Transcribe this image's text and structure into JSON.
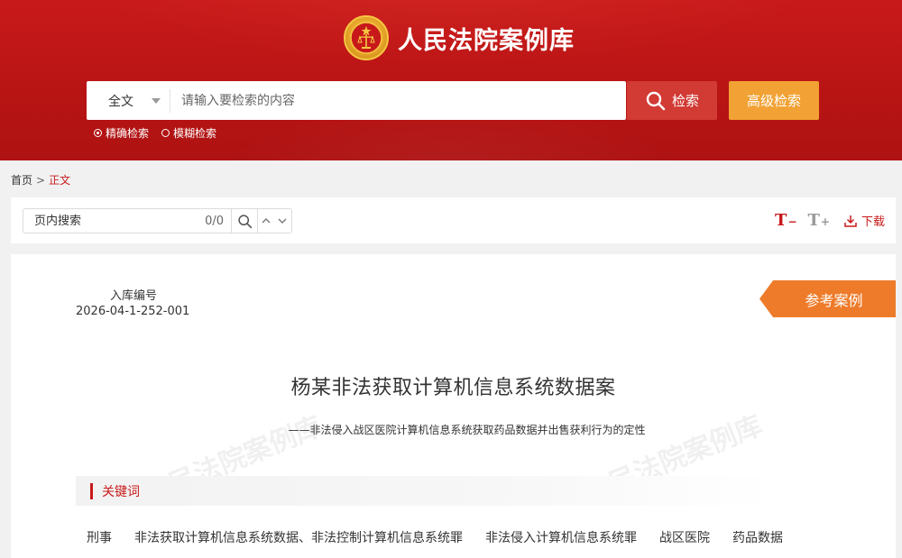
{
  "header": {
    "site_title": "人民法院案例库",
    "emblem_icon": "court-emblem-icon",
    "search": {
      "type_selected": "全文",
      "placeholder": "请输入要检索的内容",
      "search_button": "检索",
      "advanced_button": "高级检索"
    },
    "modes": [
      {
        "label": "精确检索",
        "selected": true
      },
      {
        "label": "模糊检索",
        "selected": false
      }
    ]
  },
  "breadcrumb": {
    "home": "首页",
    "separator": ">",
    "current": "正文"
  },
  "toolbar": {
    "find_placeholder": "页内搜索",
    "find_count": "0/0",
    "font_decrease_label": "T",
    "font_decrease_sub": "−",
    "font_increase_label": "T",
    "font_increase_sub": "+",
    "download_label": "下载"
  },
  "case": {
    "ref_no_label": "入库编号",
    "ref_no": "2026-04-1-252-001",
    "tag": "参考案例",
    "title": "杨某非法获取计算机信息系统数据案",
    "subtitle": "——非法侵入战区医院计算机信息系统获取药品数据并出售获利行为的定性",
    "watermark": "人民法院案例库",
    "keywords_heading": "关键词",
    "keywords": [
      "刑事",
      "非法获取计算机信息系统数据、非法控制计算机信息系统罪",
      "非法侵入计算机信息系统罪",
      "战区医院",
      "药品数据"
    ]
  },
  "colors": {
    "brand_red": "#c8191a",
    "search_red": "#d23a34",
    "advanced_orange": "#f2a234",
    "tag_orange": "#ee7b2a"
  }
}
